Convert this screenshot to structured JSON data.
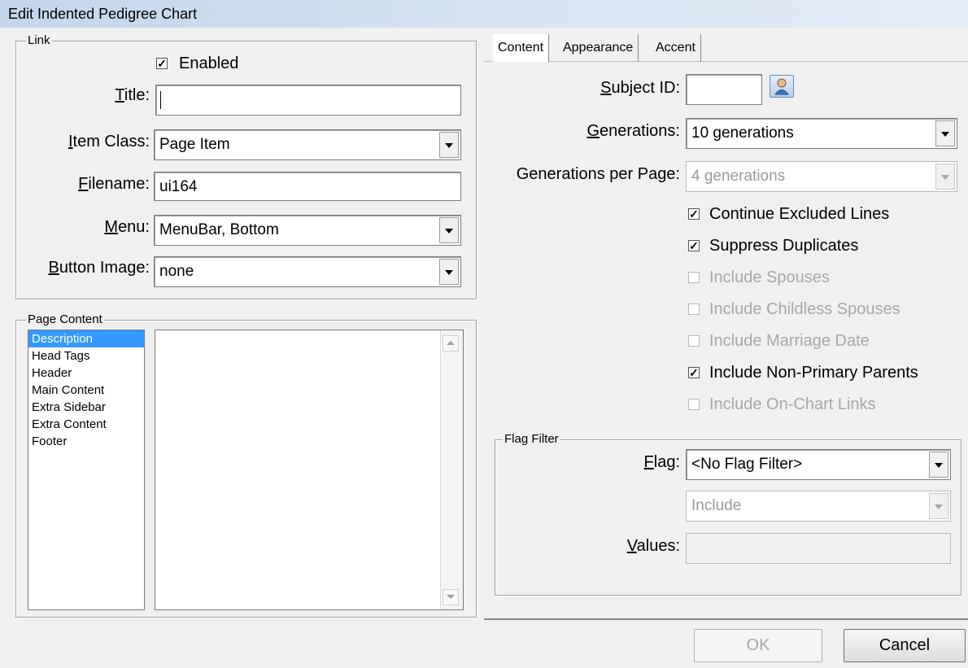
{
  "window": {
    "title": "Edit Indented Pedigree Chart"
  },
  "link": {
    "legend": "Link",
    "enabled_label": "Enabled",
    "enabled_checked": true,
    "title_label": "Title:",
    "title_value": "",
    "item_class_label": "Item Class:",
    "item_class_value": "Page Item",
    "filename_label": "Filename:",
    "filename_value": "ui164",
    "menu_label": "Menu:",
    "menu_value": "MenuBar, Bottom",
    "button_image_label": "Button Image:",
    "button_image_value": "none"
  },
  "page_content": {
    "legend": "Page Content",
    "items": [
      "Description",
      "Head Tags",
      "Header",
      "Main Content",
      "Extra Sidebar",
      "Extra Content",
      "Footer"
    ],
    "selected_index": 0,
    "editor_text": ""
  },
  "tabs": [
    {
      "label": "Content",
      "active": true
    },
    {
      "label": "Appearance",
      "active": false
    },
    {
      "label": "Accent",
      "active": false
    }
  ],
  "content": {
    "subject_id_label": "Subject ID:",
    "subject_id_value": "",
    "subject_icon": "person-picker-icon",
    "generations_label": "Generations:",
    "generations_value": "10 generations",
    "gen_per_page_label": "Generations per Page:",
    "gen_per_page_value": "4 generations",
    "checkboxes": [
      {
        "label": "Continue Excluded Lines",
        "checked": true,
        "enabled": true
      },
      {
        "label": "Suppress Duplicates",
        "checked": true,
        "enabled": true
      },
      {
        "label": "Include Spouses",
        "checked": false,
        "enabled": false
      },
      {
        "label": "Include Childless Spouses",
        "checked": false,
        "enabled": false
      },
      {
        "label": "Include Marriage Date",
        "checked": false,
        "enabled": false
      },
      {
        "label": "Include Non-Primary Parents",
        "checked": true,
        "enabled": true
      },
      {
        "label": "Include On-Chart Links",
        "checked": false,
        "enabled": false
      }
    ]
  },
  "flag_filter": {
    "legend": "Flag Filter",
    "flag_label": "Flag:",
    "flag_value": "<No Flag Filter>",
    "mode_value": "Include",
    "values_label": "Values:",
    "values_value": ""
  },
  "buttons": {
    "ok_label": "OK",
    "cancel_label": "Cancel"
  },
  "colors": {
    "selection": "#3399ff",
    "titlebar": "#c3d6ec",
    "disabled_text": "#a8a8a8"
  }
}
